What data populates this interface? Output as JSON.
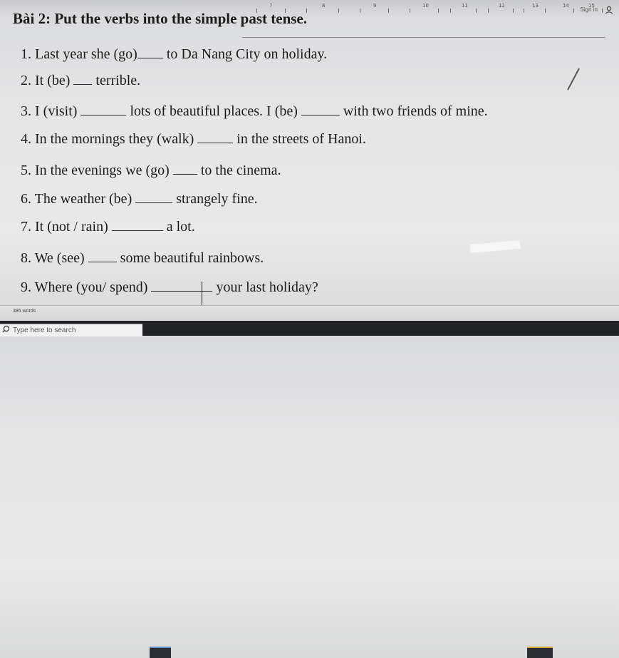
{
  "ruler": {
    "labels": [
      "7",
      "8",
      "9",
      "10",
      "11",
      "12",
      "13",
      "14",
      "15"
    ]
  },
  "header": {
    "signin_label": "Sign in"
  },
  "exercise": {
    "title": "Bài 2: Put the verbs into the simple past tense.",
    "items": [
      {
        "num": "1.",
        "before": "Last year she (go)",
        "after": "to Da Nang City on holiday."
      },
      {
        "num": "2.",
        "before": "It (be)",
        "after": "terrible."
      },
      {
        "num": "3.",
        "before": "I (visit)",
        "mid": "lots of beautiful places. I (be)",
        "after": "with two friends of mine."
      },
      {
        "num": "4.",
        "before": "In the mornings they (walk)",
        "after": "in the streets of Hanoi."
      },
      {
        "num": "5.",
        "before": "In the evenings we (go)",
        "after": "to the cinema."
      },
      {
        "num": "6.",
        "before": "The weather (be)",
        "after": "strangely fine."
      },
      {
        "num": "7.",
        "before": "It (not / rain)",
        "after": "a lot."
      },
      {
        "num": "8.",
        "before": "We (see)",
        "after": "some beautiful rainbows."
      },
      {
        "num": "9.",
        "before": "Where (you/ spend)",
        "after": "your last holiday?"
      }
    ]
  },
  "status": {
    "word_count": "385 words"
  },
  "taskbar": {
    "search_placeholder": "Type here to search"
  }
}
